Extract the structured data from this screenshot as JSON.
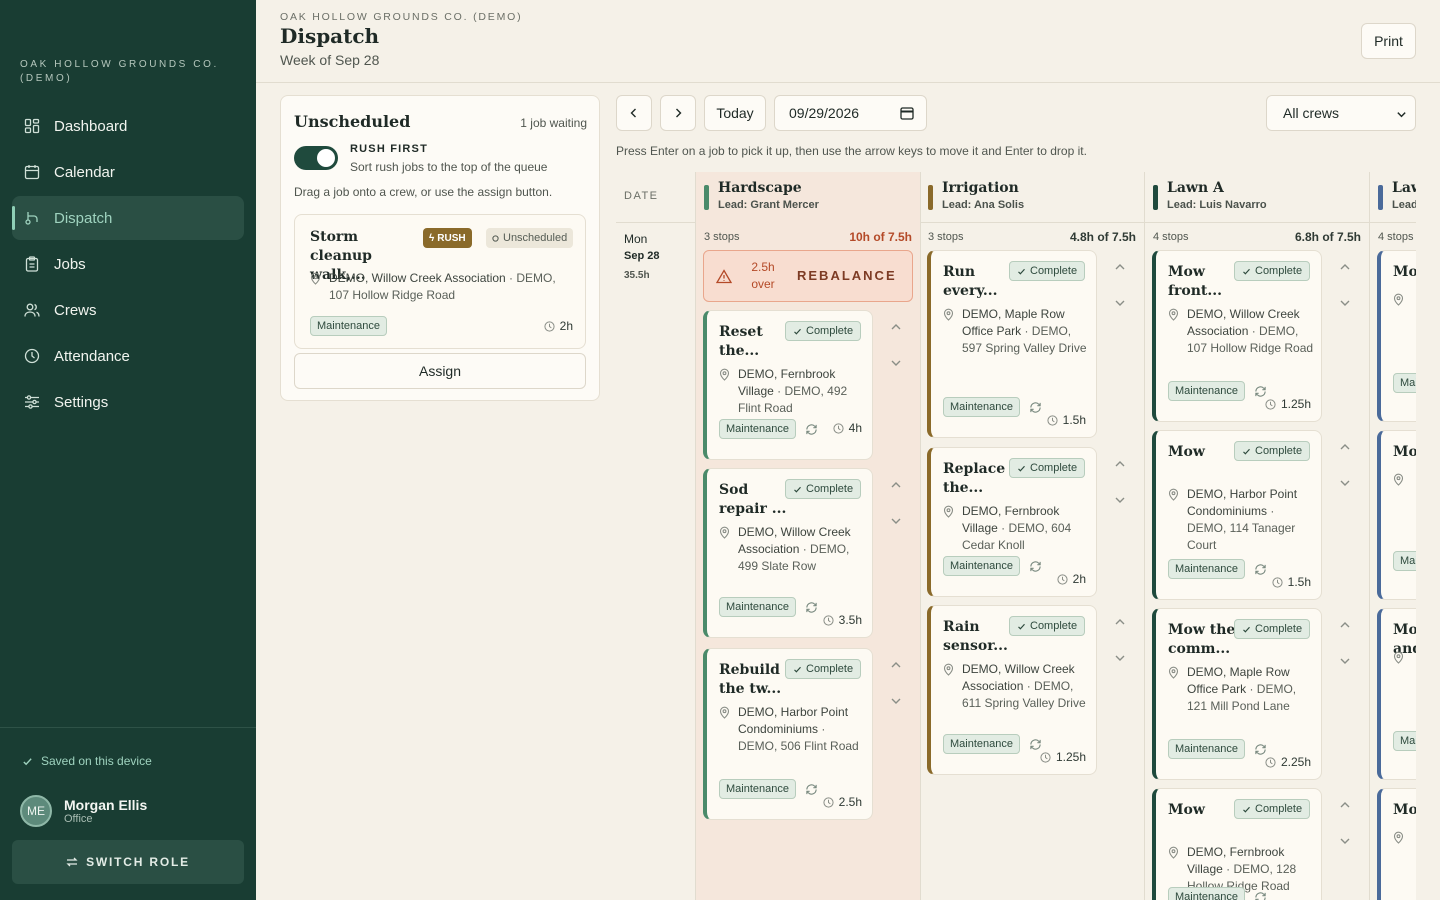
{
  "brand": "OAK HOLLOW GROUNDS CO. (DEMO)",
  "nav": [
    {
      "label": "Dashboard",
      "icon": "dashboard-icon"
    },
    {
      "label": "Calendar",
      "icon": "calendar-icon"
    },
    {
      "label": "Dispatch",
      "icon": "dispatch-icon",
      "active": true
    },
    {
      "label": "Jobs",
      "icon": "clipboard-icon"
    },
    {
      "label": "Crews",
      "icon": "users-icon"
    },
    {
      "label": "Attendance",
      "icon": "clock-icon"
    },
    {
      "label": "Settings",
      "icon": "sliders-icon"
    }
  ],
  "saved_text": "Saved on this device",
  "user": {
    "initials": "ME",
    "name": "Morgan Ellis",
    "role": "Office"
  },
  "switch_role": "SWITCH ROLE",
  "header": {
    "kicker": "OAK HOLLOW GROUNDS CO. (DEMO)",
    "title": "Dispatch",
    "subtitle": "Week of Sep 28",
    "print": "Print"
  },
  "unscheduled": {
    "title": "Unscheduled",
    "count": "1 job waiting",
    "rush_label": "RUSH FIRST",
    "rush_desc": "Sort rush jobs to the top of the queue",
    "drag_hint": "Drag a job onto a crew, or use the assign button.",
    "job": {
      "title": "Storm cleanup walk,...",
      "rush": "RUSH",
      "status": "Unscheduled",
      "loc_main": "DEMO, Willow Creek Association",
      "loc_rest": " · DEMO, 107 Hollow Ridge Road",
      "tag": "Maintenance",
      "duration": "2h"
    },
    "assign": "Assign"
  },
  "controls": {
    "today": "Today",
    "date": "09/29/2026",
    "crew_filter": "All crews",
    "hint": "Press Enter on a job to pick it up, then use the arrow keys to move it and Enter to drop it."
  },
  "board": {
    "date_header": "DATE",
    "day": {
      "dow": "Mon",
      "date": "Sep 28",
      "hours": "35.5h"
    },
    "crews": [
      {
        "name": "Hardscape",
        "lead": "Lead: Grant Mercer",
        "color": "#4a8a6a",
        "stops": "3 stops",
        "load": "10h of 7.5h",
        "over": true,
        "over_text": "2.5h over",
        "rebalance": "REBALANCE",
        "jobs": [
          {
            "title": "Reset the...",
            "status": "Complete",
            "loc_main": "DEMO, Fernbrook Village",
            "loc_rest": " · DEMO, 492 Flint Road",
            "tag": "Maintenance",
            "duration": "4h"
          },
          {
            "title": "Sod repair ...",
            "status": "Complete",
            "loc_main": "DEMO, Willow Creek Association",
            "loc_rest": " · DEMO, 499 Slate Row",
            "tag": "Maintenance",
            "duration": "3.5h"
          },
          {
            "title": "Rebuild the tw...",
            "status": "Complete",
            "loc_main": "DEMO, Harbor Point Condominiums",
            "loc_rest": " · DEMO, 506 Flint Road",
            "tag": "Maintenance",
            "duration": "2.5h"
          }
        ]
      },
      {
        "name": "Irrigation",
        "lead": "Lead: Ana Solis",
        "color": "#8a6a2a",
        "stops": "3 stops",
        "load": "4.8h of 7.5h",
        "jobs": [
          {
            "title": "Run every...",
            "status": "Complete",
            "loc_main": "DEMO, Maple Row Office Park",
            "loc_rest": " · DEMO, 597 Spring Valley Drive",
            "tag": "Maintenance",
            "duration": "1.5h"
          },
          {
            "title": "Replace the...",
            "status": "Complete",
            "loc_main": "DEMO, Fernbrook Village",
            "loc_rest": " · DEMO, 604 Cedar Knoll",
            "tag": "Maintenance",
            "duration": "2h"
          },
          {
            "title": "Rain sensor...",
            "status": "Complete",
            "loc_main": "DEMO, Willow Creek Association",
            "loc_rest": " · DEMO, 611 Spring Valley Drive",
            "tag": "Maintenance",
            "duration": "1.25h"
          }
        ]
      },
      {
        "name": "Lawn A",
        "lead": "Lead: Luis Navarro",
        "color": "#1f4a3d",
        "stops": "4 stops",
        "load": "6.8h of 7.5h",
        "jobs": [
          {
            "title": "Mow front...",
            "status": "Complete",
            "loc_main": "DEMO, Willow Creek Association",
            "loc_rest": " · DEMO, 107 Hollow Ridge Road",
            "tag": "Maintenance",
            "duration": "1.25h"
          },
          {
            "title": "Mow",
            "status": "Complete",
            "loc_main": "DEMO, Harbor Point Condominiums",
            "loc_rest": " · DEMO, 114 Tanager Court",
            "tag": "Maintenance",
            "duration": "1.5h"
          },
          {
            "title": "Mow the comm...",
            "status": "Complete",
            "loc_main": "DEMO, Maple Row Office Park",
            "loc_rest": " · DEMO, 121 Mill Pond Lane",
            "tag": "Maintenance",
            "duration": "2.25h"
          },
          {
            "title": "Mow",
            "status": "Complete",
            "loc_main": "DEMO, Fernbrook Village",
            "loc_rest": " · DEMO, 128 Hollow Ridge Road",
            "tag": "Maintenance",
            "duration": ""
          }
        ]
      },
      {
        "name": "Lawn B",
        "lead": "Lead",
        "color": "#4a6a9a",
        "stops": "4 stops",
        "load": "",
        "jobs": [
          {
            "title": "Mow",
            "tag": "Maintenance"
          },
          {
            "title": "Mow",
            "tag": "Maintenance"
          },
          {
            "title": "Mow and",
            "tag": "Maintenance"
          },
          {
            "title": "Mow",
            "tag": ""
          }
        ]
      }
    ]
  }
}
